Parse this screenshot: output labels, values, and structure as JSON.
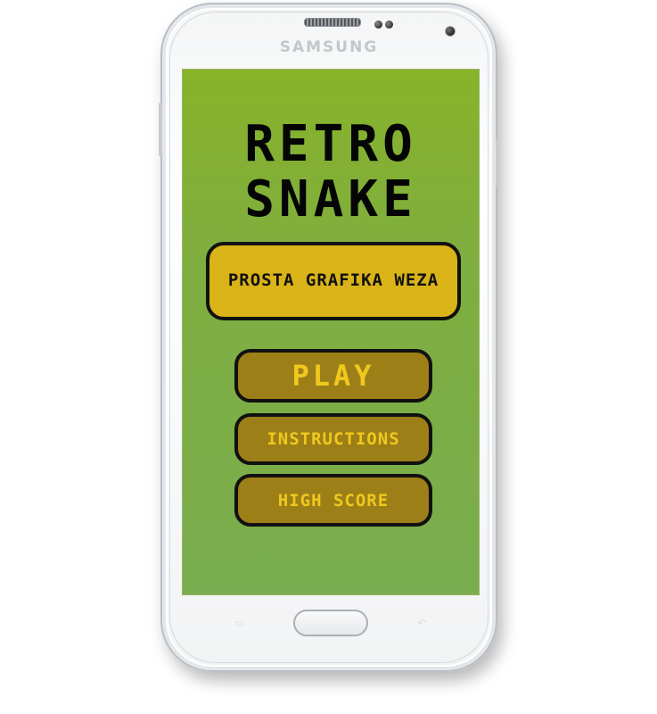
{
  "device": {
    "brand": "SAMSUNG"
  },
  "game": {
    "title_line1": "RETRO",
    "title_line2": "SNAKE",
    "banner": "PROSTA GRAFIKA WEZA",
    "buttons": {
      "play": "PLAY",
      "instructions": "INSTRUCTIONS",
      "high_score": "HIGH SCORE"
    }
  },
  "colors": {
    "screen_background": "#7fae3f",
    "banner_fill": "#dab318",
    "button_fill": "#9c7f16",
    "button_text": "#f0c81e",
    "outline": "#111111"
  },
  "icons": {
    "menu_key": "recent-apps-icon",
    "back_key": "back-icon"
  }
}
